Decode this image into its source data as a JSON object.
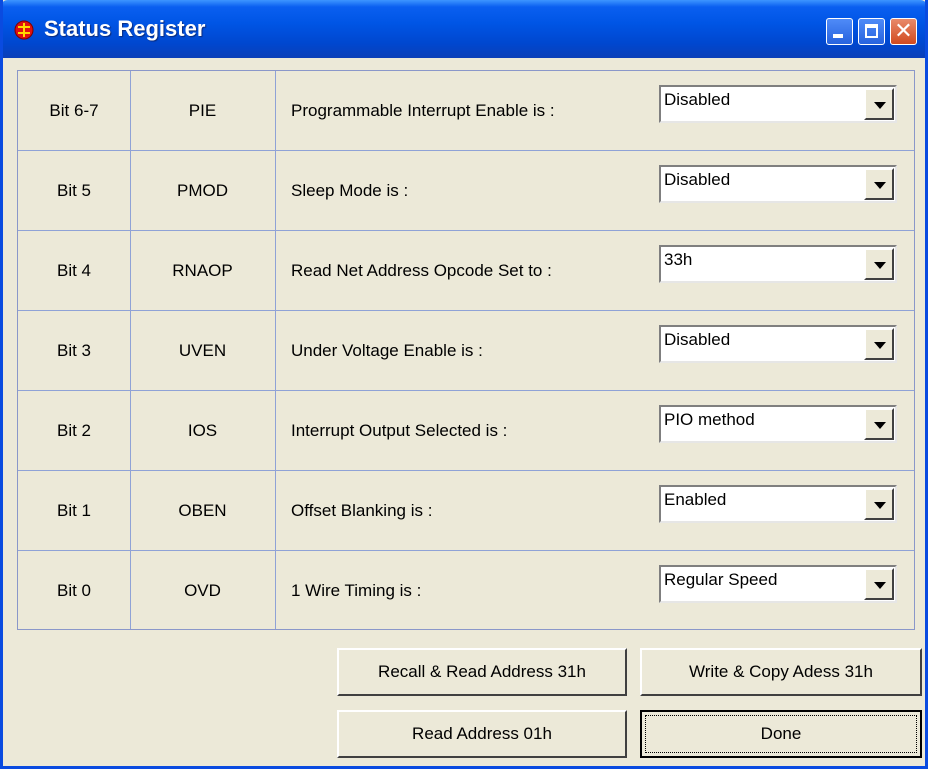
{
  "window": {
    "title": "Status Register"
  },
  "rows": [
    {
      "bit": "Bit 6-7",
      "name": "PIE",
      "description": "Programmable Interrupt Enable is :",
      "value": "Disabled"
    },
    {
      "bit": "Bit 5",
      "name": "PMOD",
      "description": "Sleep Mode is :",
      "value": "Disabled"
    },
    {
      "bit": "Bit 4",
      "name": "RNAOP",
      "description": "Read Net Address Opcode Set to :",
      "value": "33h"
    },
    {
      "bit": "Bit 3",
      "name": "UVEN",
      "description": "Under Voltage Enable is :",
      "value": "Disabled"
    },
    {
      "bit": "Bit 2",
      "name": "IOS",
      "description": "Interrupt Output Selected is :",
      "value": "PIO method"
    },
    {
      "bit": "Bit 1",
      "name": "OBEN",
      "description": "Offset Blanking is :",
      "value": "Enabled"
    },
    {
      "bit": "Bit 0",
      "name": "OVD",
      "description": "1 Wire Timing is :",
      "value": "Regular Speed"
    }
  ],
  "buttons": {
    "recall_read": "Recall & Read Address 31h",
    "write_copy": "Write & Copy Adess 31h",
    "read_01": "Read Address 01h",
    "done": "Done"
  },
  "icons": {
    "app": "maxim-logo-icon",
    "minimize": "minimize-icon",
    "maximize": "maximize-icon",
    "close": "close-icon",
    "dropdown": "chevron-down-icon"
  },
  "colors": {
    "titlebar": "#0055e5",
    "window_bg": "#ece9d8",
    "grid_line": "#8fa2d6",
    "close_button": "#d24a1f"
  }
}
